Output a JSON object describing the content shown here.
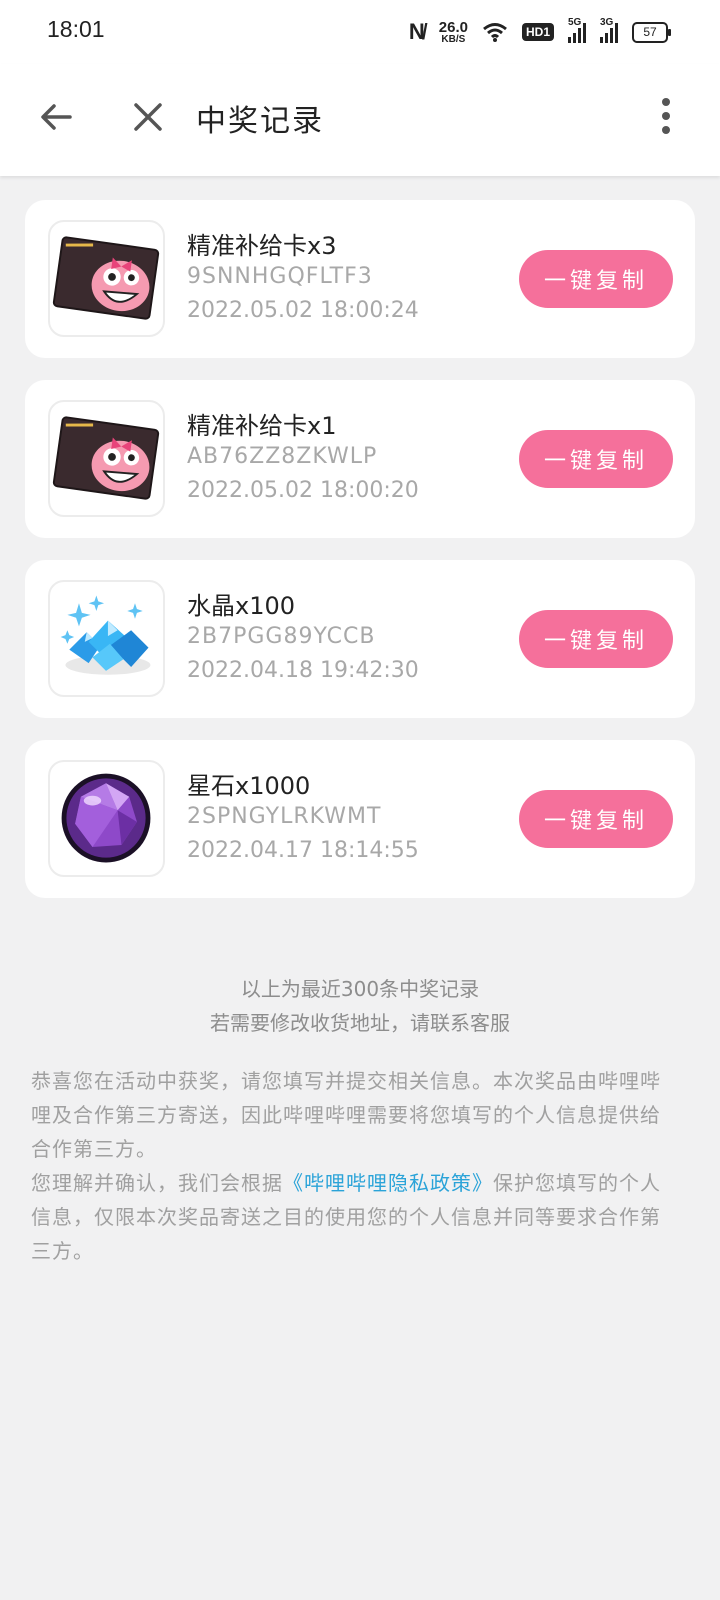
{
  "status_bar": {
    "time": "18:01",
    "net_speed": "26.0",
    "net_speed_unit": "KB/S",
    "hd_label": "HD1",
    "sim1_label": "5G",
    "sim2_label": "3G",
    "battery": "57",
    "icons": [
      "nfc-icon",
      "wifi-icon",
      "hd-icon",
      "signal-5g-icon",
      "signal-3g-icon",
      "battery-icon"
    ]
  },
  "toolbar": {
    "title": "中奖记录",
    "icons": [
      "back-arrow-icon",
      "close-icon",
      "more-vertical-icon"
    ]
  },
  "records": [
    {
      "name": "精准补给卡x3",
      "code": "9SNNHGQFLTF3",
      "time": "2022.05.02 18:00:24",
      "button": "一键复制",
      "image": "supply-card-image"
    },
    {
      "name": "精准补给卡x1",
      "code": "AB76ZZ8ZKWLP",
      "time": "2022.05.02 18:00:20",
      "button": "一键复制",
      "image": "supply-card-image"
    },
    {
      "name": "水晶x100",
      "code": "2B7PGG89YCCB",
      "time": "2022.04.18 19:42:30",
      "button": "一键复制",
      "image": "crystal-image"
    },
    {
      "name": "星石x1000",
      "code": "2SPNGYLRKWMT",
      "time": "2022.04.17 18:14:55",
      "button": "一键复制",
      "image": "star-stone-image"
    }
  ],
  "summary": {
    "line1": "以上为最近300条中奖记录",
    "line2": "若需要修改收货地址，请联系客服"
  },
  "notice": {
    "para1": "恭喜您在活动中获奖，请您填写并提交相关信息。本次奖品由哔哩哔哩及合作第三方寄送，因此哔哩哔哩需要将您填写的个人信息提供给合作第三方。",
    "para2_prefix": "您理解并确认，我们会根据",
    "para2_link": "《哔哩哔哩隐私政策》",
    "para2_suffix": "保护您填写的个人信息，仅限本次奖品寄送之目的使用您的个人信息并同等要求合作第三方。"
  },
  "colors": {
    "accent_pink": "#f5709b",
    "link_blue": "#2aa3d8",
    "background": "#f1f1f2"
  }
}
